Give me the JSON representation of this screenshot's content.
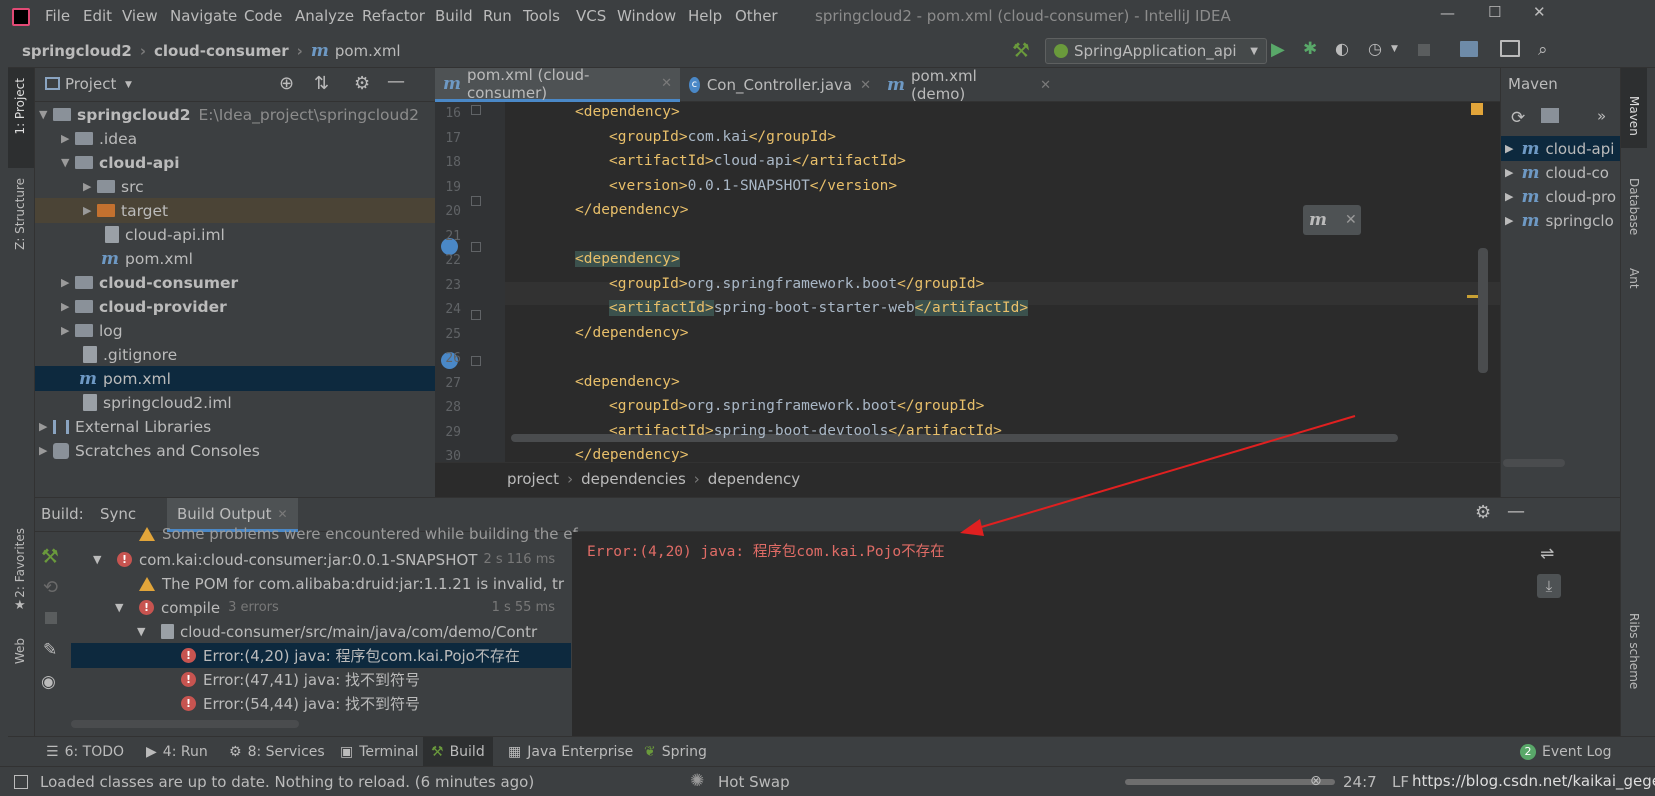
{
  "window": {
    "title": "springcloud2 - pom.xml (cloud-consumer) - IntelliJ IDEA",
    "menu": [
      "File",
      "Edit",
      "View",
      "Navigate",
      "Code",
      "Analyze",
      "Refactor",
      "Build",
      "Run",
      "Tools",
      "VCS",
      "Window",
      "Help",
      "Other"
    ]
  },
  "navbar": {
    "crumbs": [
      "springcloud2",
      "cloud-consumer",
      "pom.xml"
    ],
    "run_config": "SpringApplication_api"
  },
  "left_tool_tabs": [
    "1: Project",
    "Z: Structure",
    "2: Favorites",
    "Web"
  ],
  "right_tool_tabs": [
    "Maven",
    "Database",
    "Ant",
    "Ribs scheme"
  ],
  "project": {
    "title": "Project",
    "tree": [
      {
        "label": "springcloud2",
        "extra": "E:\\Idea_project\\springcloud2"
      },
      {
        "label": ".idea"
      },
      {
        "label": "cloud-api"
      },
      {
        "label": "src"
      },
      {
        "label": "target"
      },
      {
        "label": "cloud-api.iml"
      },
      {
        "label": "pom.xml"
      },
      {
        "label": "cloud-consumer"
      },
      {
        "label": "cloud-provider"
      },
      {
        "label": "log"
      },
      {
        "label": ".gitignore"
      },
      {
        "label": "pom.xml"
      },
      {
        "label": "springcloud2.iml"
      },
      {
        "label": "External Libraries"
      },
      {
        "label": "Scratches and Consoles"
      }
    ]
  },
  "editor": {
    "tabs": [
      "pom.xml (cloud-consumer)",
      "Con_Controller.java",
      "pom.xml (demo)"
    ],
    "lines": [
      {
        "no": "16",
        "open": "<dependency>",
        "text": "",
        "close": ""
      },
      {
        "no": "17",
        "open": "<groupId>",
        "text": "com.kai",
        "close": "</groupId>"
      },
      {
        "no": "18",
        "open": "<artifactId>",
        "text": "cloud-api",
        "close": "</artifactId>"
      },
      {
        "no": "19",
        "open": "<version>",
        "text": "0.0.1-SNAPSHOT",
        "close": "</version>"
      },
      {
        "no": "20",
        "open": "</dependency>",
        "text": "",
        "close": ""
      },
      {
        "no": "21",
        "open": "",
        "text": "",
        "close": ""
      },
      {
        "no": "22",
        "open": "<dependency>",
        "text": "",
        "close": ""
      },
      {
        "no": "23",
        "open": "<groupId>",
        "text": "org.springframework.boot",
        "close": "</groupId>"
      },
      {
        "no": "24",
        "open": "<artifactId>",
        "text": "spring-boot-starter-web",
        "close": "</artifactId>"
      },
      {
        "no": "25",
        "open": "</dependency>",
        "text": "",
        "close": ""
      },
      {
        "no": "26",
        "open": "",
        "text": "",
        "close": ""
      },
      {
        "no": "27",
        "open": "<dependency>",
        "text": "",
        "close": ""
      },
      {
        "no": "28",
        "open": "<groupId>",
        "text": "org.springframework.boot",
        "close": "</groupId>"
      },
      {
        "no": "29",
        "open": "<artifactId>",
        "text": "spring-boot-devtools",
        "close": "</artifactId>"
      },
      {
        "no": "30",
        "open": "</dependency>",
        "text": "",
        "close": ""
      }
    ],
    "breadcrumb": [
      "project",
      "dependencies",
      "dependency"
    ]
  },
  "maven": {
    "title": "Maven",
    "items": [
      "cloud-api",
      "cloud-co",
      "cloud-pro",
      "springclo"
    ]
  },
  "build": {
    "label": "Build:",
    "tabs": [
      "Sync",
      "Build Output"
    ],
    "tree": [
      {
        "text": "Some problems were encountered while building the ef",
        "time": ""
      },
      {
        "text": "com.kai:cloud-consumer:jar:0.0.1-SNAPSHOT",
        "time": "2 s 116 ms"
      },
      {
        "text": "The POM for com.alibaba:druid:jar:1.1.21 is invalid, tr",
        "time": ""
      },
      {
        "text": "compile",
        "sub": "3 errors",
        "time": "1 s 55 ms"
      },
      {
        "text": "cloud-consumer/src/main/java/com/demo/Contr",
        "time": ""
      },
      {
        "text": "Error:(4,20) java: 程序包com.kai.Pojo不存在",
        "time": ""
      },
      {
        "text": "Error:(47,41) java: 找不到符号",
        "time": ""
      },
      {
        "text": "Error:(54,44) java: 找不到符号",
        "time": ""
      }
    ],
    "output": "Error:(4,20) java: 程序包com.kai.Pojo不存在"
  },
  "bottom_tabs": [
    "6: TODO",
    "4: Run",
    "8: Services",
    "Terminal",
    "Build",
    "Java Enterprise",
    "Spring",
    "Event Log"
  ],
  "event_log_count": "2",
  "status": {
    "message": "Loaded classes are up to date. Nothing to reload. (6 minutes ago)",
    "hotswap": "Hot Swap",
    "position": "24:7",
    "line_sep": "LF",
    "watermark": "https://blog.csdn.net/kaikai_gege"
  },
  "colors": {
    "error": "#c75450",
    "arrow": "#e02020",
    "selection": "#0d293e",
    "tag": "#e8bf6a",
    "text": "#a9b7c6"
  }
}
